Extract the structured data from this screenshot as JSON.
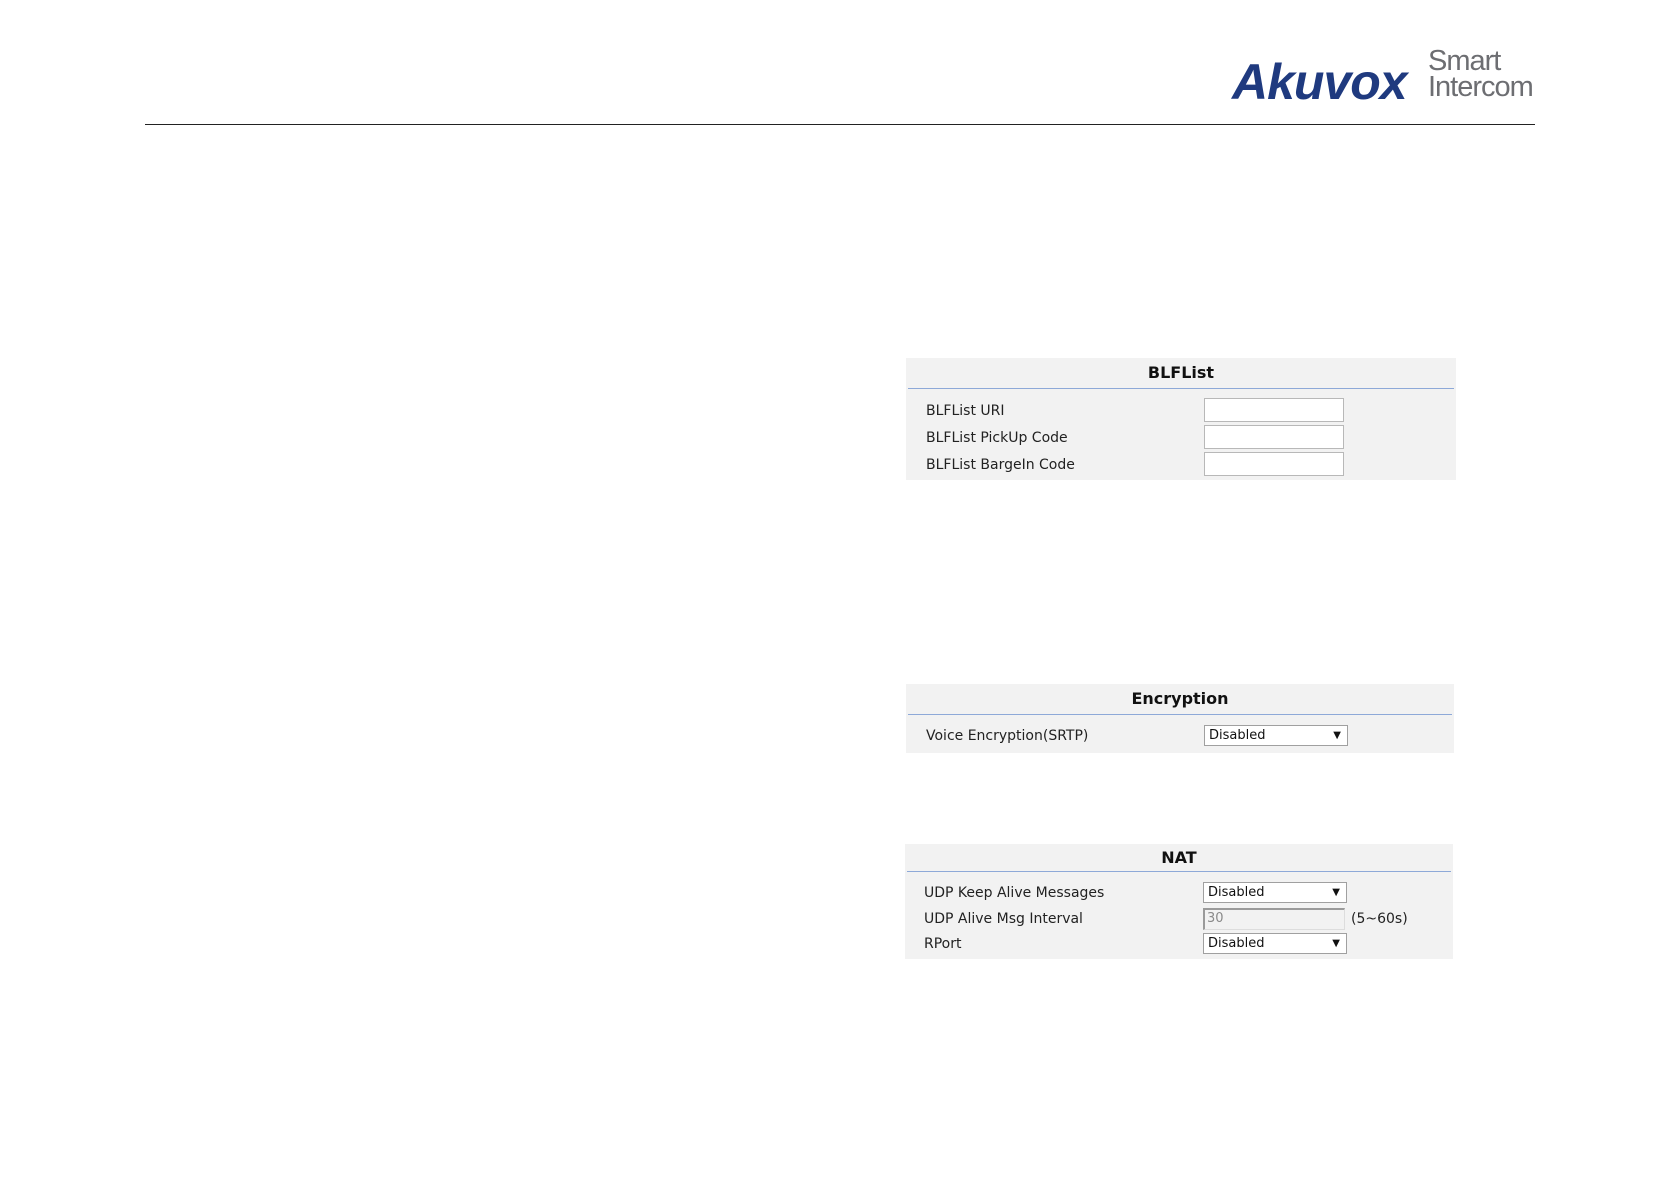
{
  "header": {
    "logo_brand": "Akuvox",
    "logo_tag_line1": "Smart",
    "logo_tag_line2": "Intercom"
  },
  "blflist": {
    "title": "BLFList",
    "fields": [
      {
        "label": "BLFList URI",
        "value": ""
      },
      {
        "label": "BLFList PickUp Code",
        "value": ""
      },
      {
        "label": "BLFList BargeIn Code",
        "value": ""
      }
    ]
  },
  "encryption": {
    "title": "Encryption",
    "voice_encryption": {
      "label": "Voice Encryption(SRTP)",
      "value": "Disabled"
    }
  },
  "nat": {
    "title": "NAT",
    "udp_keep_alive": {
      "label": "UDP Keep Alive Messages",
      "value": "Disabled"
    },
    "udp_alive_interval": {
      "label": "UDP Alive Msg Interval",
      "value": "30",
      "hint": "(5~60s)"
    },
    "rport": {
      "label": "RPort",
      "value": "Disabled"
    }
  },
  "icons": {
    "dropdown": "chevron-down-icon"
  },
  "colors": {
    "brand_blue": "#1f3a7f",
    "brand_gray": "#6d6e72",
    "panel_bg": "#f2f2f2",
    "title_rule": "#8ea9d8"
  }
}
